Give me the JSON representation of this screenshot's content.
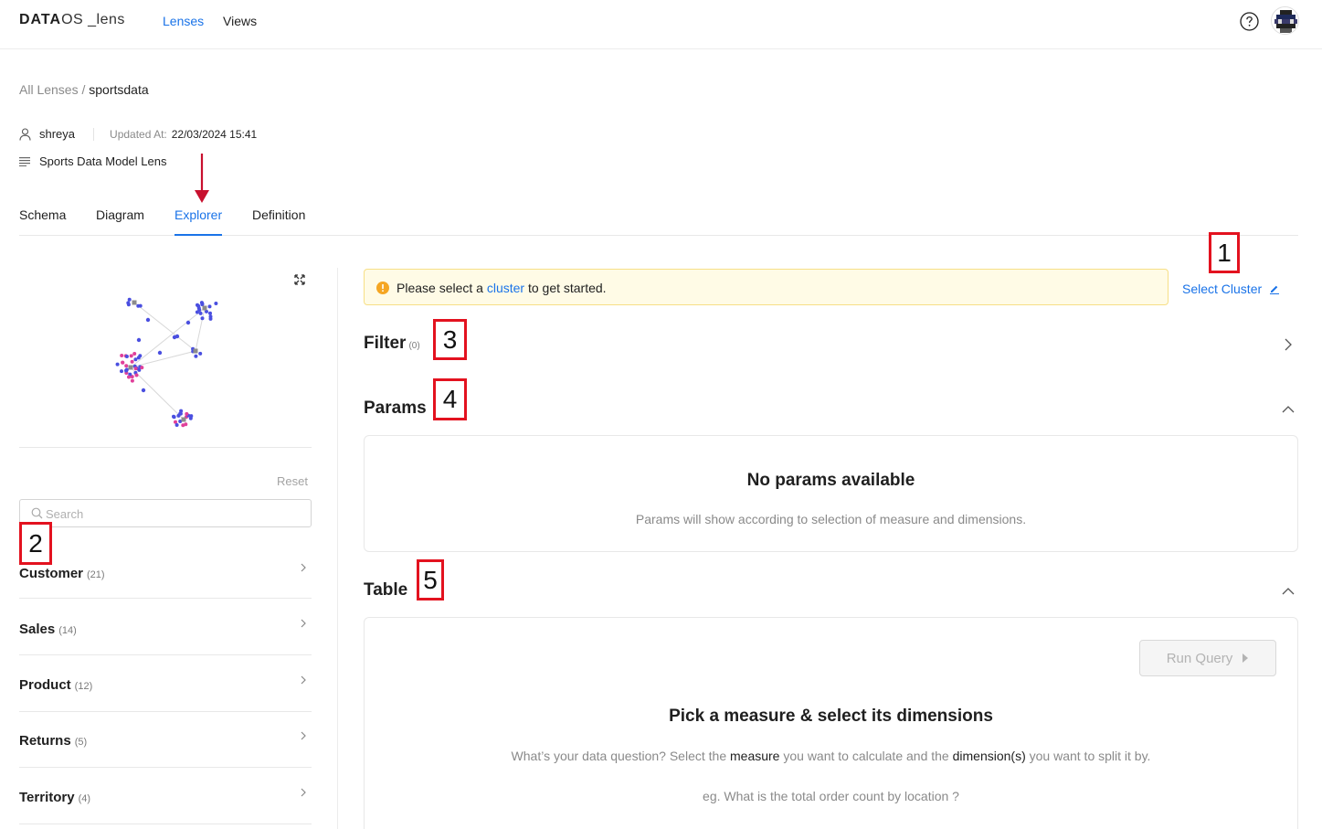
{
  "topbar": {
    "logo_brand": "DATA",
    "logo_os": "OS",
    "logo_suffix": "_lens",
    "nav": [
      "Lenses",
      "Views"
    ],
    "active_nav": "Lenses",
    "help_icon": "help-circle-icon",
    "avatar_icon": "user-avatar"
  },
  "breadcrumb": {
    "root": "All Lenses",
    "sep": "/",
    "current": "sportsdata"
  },
  "meta": {
    "owner": "shreya",
    "updated_label": "Updated At:",
    "updated_value": "22/03/2024 15:41",
    "description": "Sports Data Model Lens"
  },
  "tabs": [
    "Schema",
    "Diagram",
    "Explorer",
    "Definition"
  ],
  "active_tab": "Explorer",
  "left_panel": {
    "reset_label": "Reset",
    "search_placeholder": "Search",
    "entities": [
      {
        "name": "Customer",
        "count": "(21)"
      },
      {
        "name": "Sales",
        "count": "(14)"
      },
      {
        "name": "Product",
        "count": "(12)"
      },
      {
        "name": "Returns",
        "count": "(5)"
      },
      {
        "name": "Territory",
        "count": "(4)"
      }
    ]
  },
  "alert": {
    "prefix": "Please select a",
    "link": "cluster",
    "suffix": "to get started."
  },
  "select_cluster_label": "Select Cluster",
  "filter": {
    "title": "Filter",
    "count": "(0)"
  },
  "params": {
    "title": "Params",
    "empty_title": "No params available",
    "empty_sub": "Params will show according to selection of measure and dimensions."
  },
  "table": {
    "title": "Table",
    "run_query_label": "Run Query",
    "empty_title": "Pick a measure & select its dimensions",
    "empty_sub_1": "What’s your data question? Select the",
    "empty_sub_measure": "measure",
    "empty_sub_2": "you want to calculate and the",
    "empty_sub_dimension": "dimension(s)",
    "empty_sub_3": "you want to split it by.",
    "example": "eg. What is the total order count by location ?"
  },
  "annotations": [
    "1",
    "2",
    "3",
    "4",
    "5"
  ],
  "colors": {
    "accent": "#1a73e8",
    "alert_bg": "#fffbe6",
    "alert_border": "#f7df86",
    "warning": "#f5a623",
    "annotation_red": "#e3121f",
    "graph_node_blue": "#4a4fe0",
    "graph_node_pink": "#e0409a",
    "graph_node_gray": "#8c8c8c"
  }
}
